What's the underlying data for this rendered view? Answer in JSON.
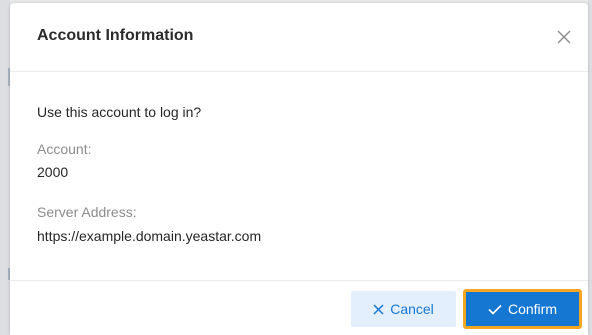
{
  "dialog": {
    "title": "Account Information",
    "close_icon": "close-icon",
    "prompt": "Use this account to log in?",
    "account_label": "Account:",
    "account_value": "2000",
    "server_label": "Server Address:",
    "server_value": "https://example.domain.yeastar.com",
    "cancel_label": "Cancel",
    "confirm_label": "Confirm"
  },
  "colors": {
    "accent": "#1677d2",
    "cancel_bg": "#e3effc",
    "focus_outline": "#f5a623"
  }
}
